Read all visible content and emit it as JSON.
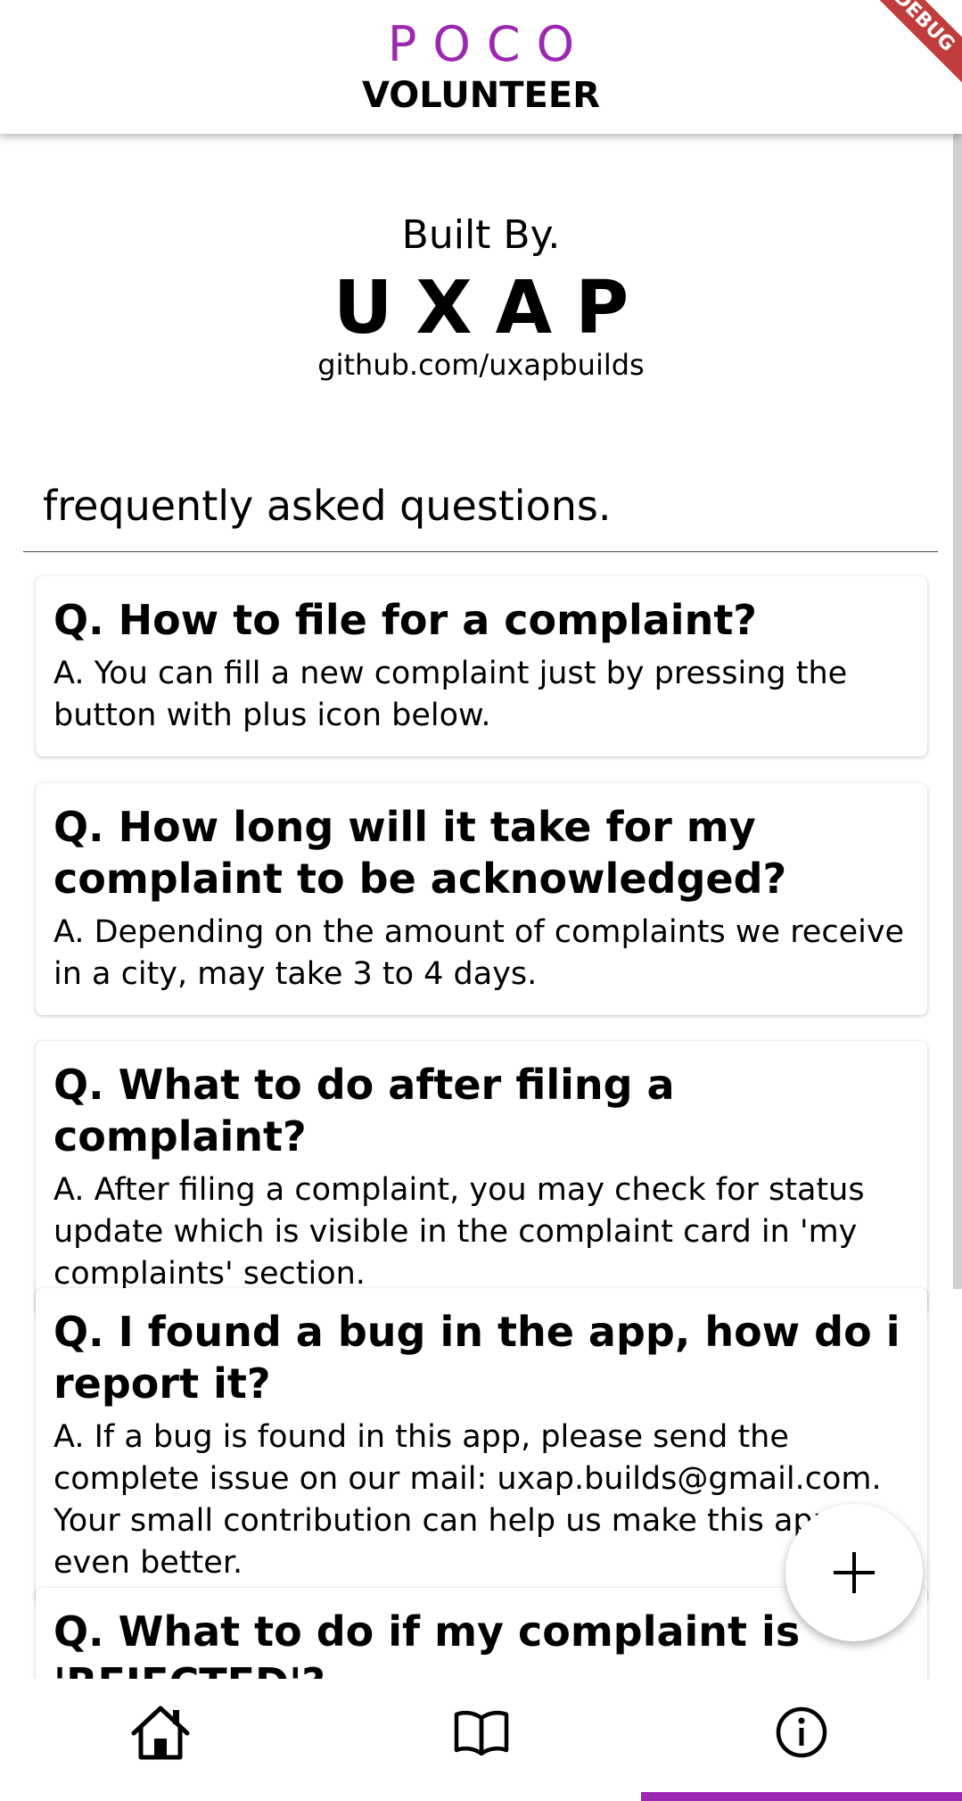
{
  "appbar": {
    "brand": "POCO",
    "subtitle": "VOLUNTEER",
    "debug_banner": "DEBUG"
  },
  "credits": {
    "built_by": "Built By.",
    "name": "UXAP",
    "link": "github.com/uxapbuilds"
  },
  "faq": {
    "title": "frequently asked questions.",
    "items": [
      {
        "q": "Q. How to file for a complaint?",
        "a": "A. You can fill a new complaint just by pressing the button with plus icon below."
      },
      {
        "q": "Q. How long will it take for my complaint to be acknowledged?",
        "a": "A. Depending on the amount of complaints we receive in a city, may take 3 to 4 days."
      },
      {
        "q": "Q. What to do after filing a complaint?",
        "a": "A. After filing a complaint, you may check for status update which is visible in the complaint card in 'my complaints' section."
      },
      {
        "q": "Q. I found a bug in the app, how do i report it?",
        "a": "A. If a bug is found in this app, please send the complete issue on our mail: uxap.builds@gmail.com. Your small contribution can help us make this app even better."
      },
      {
        "q": "Q. What to do if my complaint is 'REJECTED'?",
        "a": ""
      }
    ]
  },
  "fab": {
    "icon": "plus-icon"
  },
  "bottom_nav": {
    "items": [
      {
        "icon": "home-icon",
        "active": false
      },
      {
        "icon": "book-icon",
        "active": false
      },
      {
        "icon": "info-icon",
        "active": true
      }
    ],
    "accent": "#9c27b0"
  }
}
